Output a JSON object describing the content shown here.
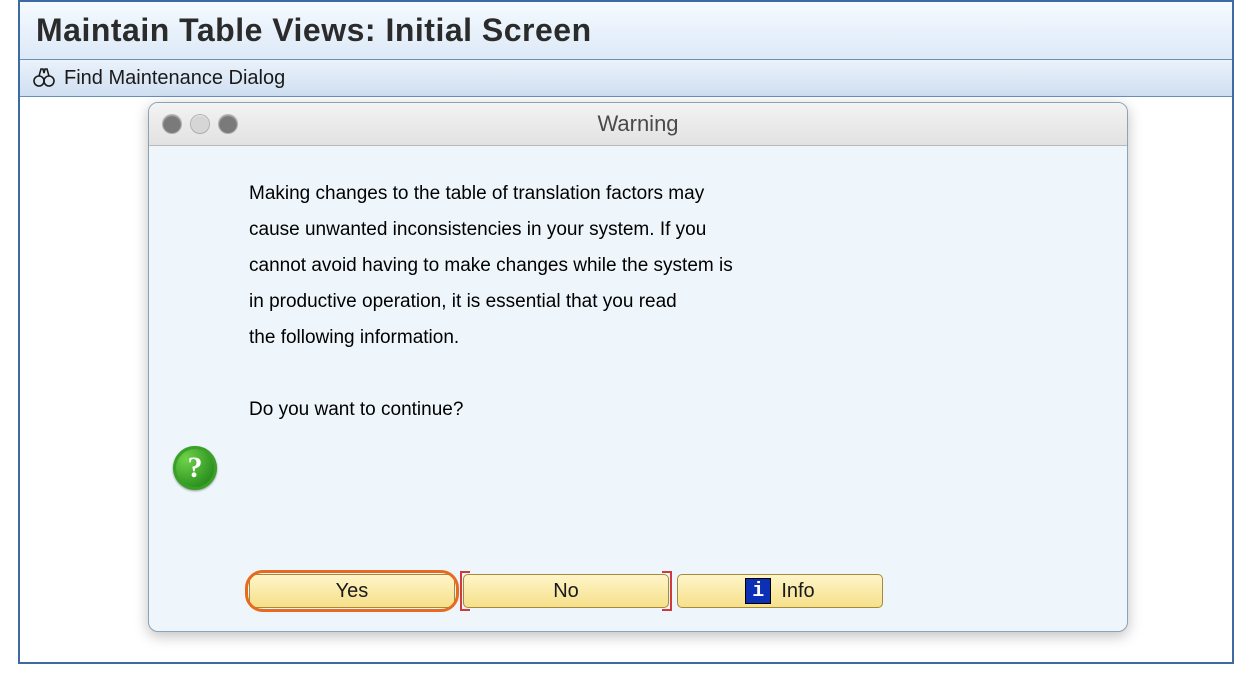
{
  "header": {
    "page_title": "Maintain Table Views: Initial Screen"
  },
  "toolbar": {
    "find_dialog_label": "Find Maintenance Dialog"
  },
  "dialog": {
    "title": "Warning",
    "message": "Making changes to the table of translation factors may\ncause unwanted inconsistencies in your system. If you\ncannot avoid having to make changes while the system is\nin productive operation, it is essential that you read\nthe following information.\n\nDo you want to continue?",
    "buttons": {
      "yes": "Yes",
      "no": "No",
      "info": "Info"
    }
  }
}
